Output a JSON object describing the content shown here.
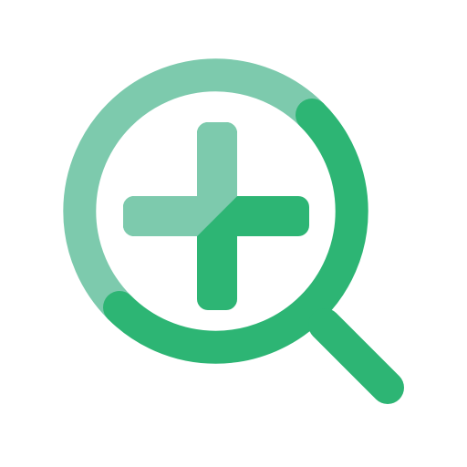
{
  "icon": {
    "name": "zoom-in-icon",
    "parts": [
      "magnifier-lens-ring",
      "magnifier-handle",
      "plus-sign"
    ]
  },
  "colors": {
    "background": "#ffffff",
    "primary": "#2db574",
    "secondary": "#7dcaad"
  }
}
